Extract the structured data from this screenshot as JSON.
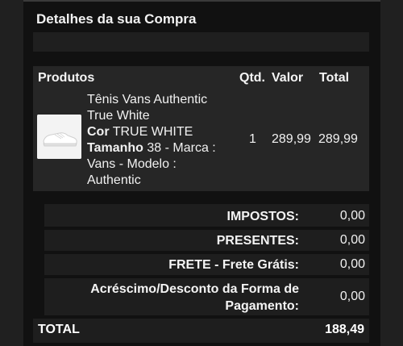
{
  "section_title": "Detalhes da sua Compra",
  "products_table": {
    "headers": {
      "product": "Produtos",
      "qty": "Qtd.",
      "value": "Valor",
      "total": "Total"
    },
    "item": {
      "name_line1": "Tênis Vans Authentic",
      "name_line2": "True White",
      "color_label": "Cor",
      "color_value": "TRUE WHITE",
      "size_label": "Tamanho",
      "size_value": "38 - Marca :",
      "line_brand": "Vans - Modelo :",
      "line_model": "Authentic",
      "qty": "1",
      "value": "289,99",
      "total": "289,99",
      "image_icon": "sneaker-thumbnail"
    }
  },
  "summary": {
    "taxes_label": "IMPOSTOS:",
    "taxes_value": "0,00",
    "gifts_label": "PRESENTES:",
    "gifts_value": "0,00",
    "shipping_label": "FRETE - Frete Grátis:",
    "shipping_value": "0,00",
    "payment_adj_label_line1": "Acréscimo/Desconto da Forma de",
    "payment_adj_label_line2": "Pagamento:",
    "payment_adj_value": "0,00"
  },
  "total": {
    "label": "TOTAL",
    "value": "188,49"
  }
}
